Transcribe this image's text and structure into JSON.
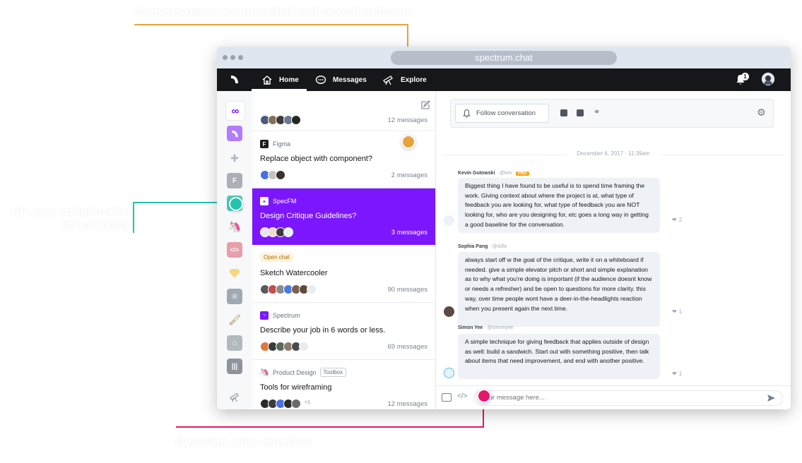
{
  "callouts": {
    "top": "Conversations are threaded and search-indexed",
    "left_line1": "All your communities",
    "left_line2": "in one place",
    "bottom": "Real-time chat interface"
  },
  "colors": {
    "accent": "#7b16ff",
    "orange": "#e8a23a",
    "teal": "#20c4ae",
    "pink": "#e5166a",
    "nav": "#16171a"
  },
  "browser": {
    "url": "spectrum.chat"
  },
  "nav": {
    "logo": "spectrum-logo-icon",
    "items": [
      {
        "label": "Home",
        "icon": "home-icon"
      },
      {
        "label": "Messages",
        "icon": "message-icon"
      },
      {
        "label": "Explore",
        "icon": "telescope-icon"
      }
    ],
    "notification_count": "1"
  },
  "communities": [
    {
      "name": "everything",
      "icon": "infinity-icon"
    },
    {
      "name": "Spectrum",
      "icon": "spectrum-icon"
    },
    {
      "name": "add",
      "icon": "plus-icon"
    },
    {
      "name": "Figma",
      "icon": "figma-icon"
    },
    {
      "name": "SpecFM",
      "icon": "specfm-icon"
    },
    {
      "name": "Product Design",
      "icon": "unicorn-icon"
    },
    {
      "name": "community-7",
      "icon": "code-icon"
    },
    {
      "name": "Sketch",
      "icon": "diamond-icon"
    },
    {
      "name": "React",
      "icon": "atom-icon"
    },
    {
      "name": "community-10",
      "icon": "brush-icon"
    },
    {
      "name": "community-11",
      "icon": "arch-icon"
    },
    {
      "name": "community-12",
      "icon": "bars-icon"
    },
    {
      "name": "explore",
      "icon": "telescope-icon"
    }
  ],
  "threads": [
    {
      "channel": "",
      "title": "",
      "count": "12 messages"
    },
    {
      "channel": "Figma",
      "title": "Replace object with component?",
      "count": "2 messages"
    },
    {
      "channel": "SpecFM",
      "title": "Design Critique Guidelines?",
      "count": "3 messages"
    },
    {
      "channel": "Open chat",
      "title": "Sketch Watercooler",
      "count": "90 messages"
    },
    {
      "channel": "Spectrum",
      "title": "Describe your job in 6 words or less.",
      "count": "69 messages"
    },
    {
      "channel": "Product Design",
      "tag": "Toolbox",
      "title": "Tools for wireframing",
      "count": "12 messages",
      "extra": "+1"
    }
  ],
  "conversation": {
    "follow_label": "Follow conversation",
    "date": "December 6, 2017 · 11:39am",
    "messages": [
      {
        "author": "Kevin Gutowski",
        "handle": "· @kev",
        "badge": "PRO",
        "text": "Biggest thing I have found to be useful is to spend time framing the work. Giving context about where the project is at, what type of feedback you are looking for, what type of feedback you are NOT looking for, who are you designing for, etc goes a long way in getting a good baseline for the conversation.",
        "reactions": "2"
      },
      {
        "author": "Sophia Pang",
        "handle": "· @s0fa",
        "badge": "",
        "text": "always start off w the goal of the critique, write it on a whiteboard if needed. give a simple elevator pitch or short and simple explanation as to why what you're doing is important (if the audience doesnt know or needs a refresher) and be open to questions for more clarity. this way, over time people wont have a deer-in-the-headlights reaction when you present again the next time.",
        "reactions": "1"
      },
      {
        "author": "Simon Yee",
        "handle": "· @simonyee",
        "badge": "",
        "text": "A simple technique for giving feedback that applies outside of design as well: build a sandwich. Start out with something positive, then talk about items that need improvement, and end with another positive.",
        "reactions": "1"
      }
    ],
    "composer_placeholder": "Your message here..."
  }
}
